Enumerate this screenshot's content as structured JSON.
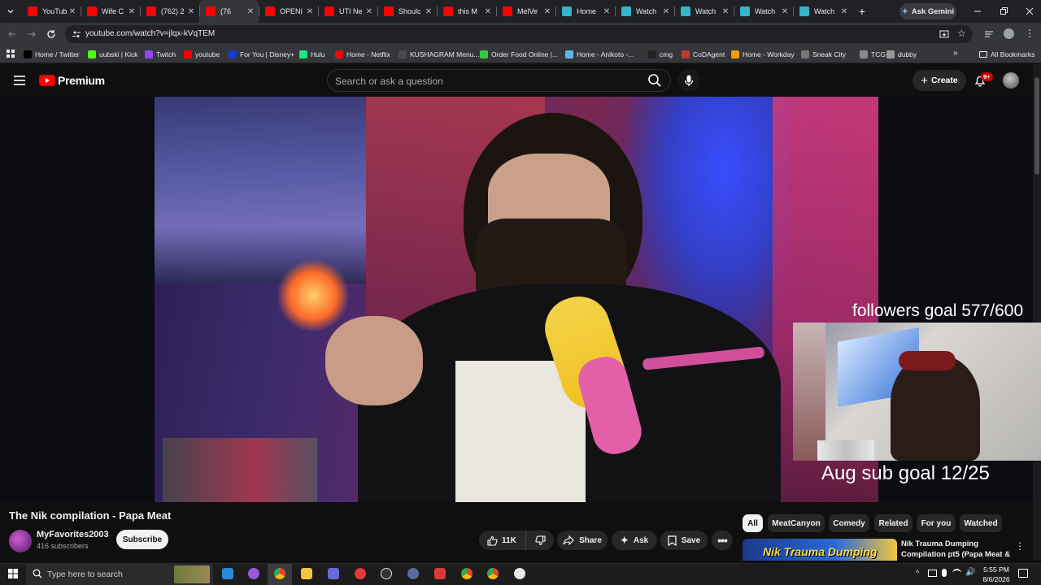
{
  "browser": {
    "tabs": [
      {
        "label": "YouTub",
        "color": "#ff0000"
      },
      {
        "label": "Wife C",
        "color": "#ff0000"
      },
      {
        "label": "(762) 2",
        "color": "#ff0000"
      },
      {
        "label": "(76",
        "color": "#ff0000",
        "active": true
      },
      {
        "label": "OPENI",
        "color": "#ff0000"
      },
      {
        "label": "UTI Ne",
        "color": "#ff0000"
      },
      {
        "label": "Shoulc",
        "color": "#ff0000"
      },
      {
        "label": "this M",
        "color": "#ff0000"
      },
      {
        "label": "MelVe",
        "color": "#ff0000"
      },
      {
        "label": "Home",
        "color": "#34b5c9"
      },
      {
        "label": "Watch",
        "color": "#34b5c9"
      },
      {
        "label": "Watch",
        "color": "#34b5c9"
      },
      {
        "label": "Watch",
        "color": "#34b5c9"
      },
      {
        "label": "Watch",
        "color": "#34b5c9"
      }
    ],
    "ask_gemini": "Ask Gemini",
    "url": "youtube.com/watch?v=jlqx-kVqTEM",
    "bookmarks": [
      {
        "label": "Home / Twitter",
        "color": "#000000"
      },
      {
        "label": "uubski | Kick",
        "color": "#53fc18"
      },
      {
        "label": "Twitch",
        "color": "#9146ff"
      },
      {
        "label": "youtube",
        "color": "#ff0000"
      },
      {
        "label": "For You | Disney+",
        "color": "#113ccf"
      },
      {
        "label": "Hulu",
        "color": "#1ce783"
      },
      {
        "label": "Home - Netflix",
        "color": "#e50914"
      },
      {
        "label": "KUSHAGRAM Menu...",
        "color": "#4a4a4a"
      },
      {
        "label": "Order Food Online |...",
        "color": "#2ecc40"
      },
      {
        "label": "Home - Anikoto -...",
        "color": "#5ab9ea"
      },
      {
        "label": "cmg",
        "color": "#222222"
      },
      {
        "label": "CoDAgent",
        "color": "#c0392b"
      },
      {
        "label": "Home - Workday",
        "color": "#f39c12"
      },
      {
        "label": "Sneak City",
        "color": "#777777"
      },
      {
        "label": "TCG",
        "color": "#888888"
      },
      {
        "label": "dubby",
        "color": "#999999"
      }
    ],
    "all_bookmarks": "All Bookmarks"
  },
  "youtube": {
    "logo_text": "Premium",
    "search_placeholder": "Search or ask a question",
    "create_label": "Create",
    "notification_badge": "9+"
  },
  "overlay": {
    "followers_goal": "followers goal 577/600",
    "sub_goal": "Aug sub goal 12/25"
  },
  "video": {
    "title": "The Nik compilation - Papa Meat",
    "channel": "MyFavorites2003",
    "subscribers": "416 subscribers",
    "subscribe_label": "Subscribe",
    "likes": "11K",
    "share_label": "Share",
    "ask_label": "Ask",
    "save_label": "Save"
  },
  "chips": [
    "All",
    "MeatCanyon",
    "Comedy",
    "Related",
    "For you",
    "Watched"
  ],
  "recommendation": {
    "thumb_text": "Nik Trauma Dumping",
    "title": "Nik Trauma Dumping Compilation pt5 (Papa Meat & ..."
  },
  "taskbar": {
    "search_placeholder": "Type here to search",
    "time": "5:55 PM",
    "date": "8/6/2026"
  },
  "colors": {
    "yt_red": "#ff0000",
    "background": "#0f0f0f",
    "chip_bg": "#272727"
  }
}
